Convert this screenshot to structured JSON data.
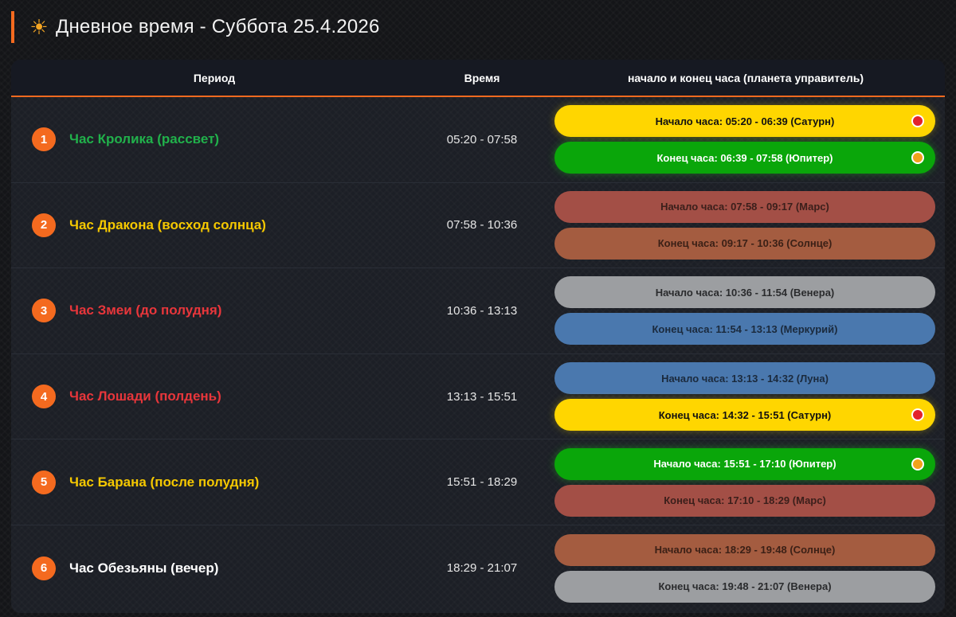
{
  "header": {
    "icon": "sun-icon",
    "title": "Дневное время - Суббота 25.4.2026",
    "accent": "#f46a1f"
  },
  "table": {
    "columns": {
      "period": "Период",
      "time": "Время",
      "hours": "начало и конец часа (планета управитель)"
    },
    "rows": [
      {
        "num": "1",
        "name": "Час Кролика (рассвет)",
        "name_color": "#21b14b",
        "time": "05:20 - 07:58",
        "hours": [
          {
            "label": "Начало часа: 05:20 - 06:39 (Сатурн)",
            "bg": "#ffd600",
            "fg": "#111111",
            "active": true,
            "dot": "#e3222b"
          },
          {
            "label": "Конец часа: 06:39 - 07:58 (Юпитер)",
            "bg": "#0aa60a",
            "fg": "#ffffff",
            "active": true,
            "dot": "#f2a21b"
          }
        ]
      },
      {
        "num": "2",
        "name": "Час Дракона (восход солнца)",
        "name_color": "#f5c800",
        "time": "07:58 - 10:36",
        "hours": [
          {
            "label": "Начало часа: 07:58 - 09:17 (Марс)",
            "bg": "#a34f46",
            "fg": "#3b1f1b",
            "active": false
          },
          {
            "label": "Конец часа: 09:17 - 10:36 (Солнце)",
            "bg": "#a45c40",
            "fg": "#3b2016",
            "active": false
          }
        ]
      },
      {
        "num": "3",
        "name": "Час Змеи (до полудня)",
        "name_color": "#e8363b",
        "time": "10:36 - 13:13",
        "hours": [
          {
            "label": "Начало часа: 10:36 - 11:54 (Венера)",
            "bg": "#9c9ea1",
            "fg": "#2a2b2d",
            "active": false
          },
          {
            "label": "Конец часа: 11:54 - 13:13 (Меркурий)",
            "bg": "#4a78ae",
            "fg": "#1b2a3d",
            "active": false
          }
        ]
      },
      {
        "num": "4",
        "name": "Час Лошади (полдень)",
        "name_color": "#e8363b",
        "time": "13:13 - 15:51",
        "hours": [
          {
            "label": "Начало часа: 13:13 - 14:32 (Луна)",
            "bg": "#4a78ae",
            "fg": "#1b2a3d",
            "active": false
          },
          {
            "label": "Конец часа: 14:32 - 15:51 (Сатурн)",
            "bg": "#ffd600",
            "fg": "#111111",
            "active": true,
            "dot": "#e3222b"
          }
        ]
      },
      {
        "num": "5",
        "name": "Час Барана (после полудня)",
        "name_color": "#f5c800",
        "time": "15:51 - 18:29",
        "hours": [
          {
            "label": "Начало часа: 15:51 - 17:10 (Юпитер)",
            "bg": "#0aa60a",
            "fg": "#ffffff",
            "active": true,
            "dot": "#f2a21b"
          },
          {
            "label": "Конец часа: 17:10 - 18:29 (Марс)",
            "bg": "#a34f46",
            "fg": "#3b1f1b",
            "active": false
          }
        ]
      },
      {
        "num": "6",
        "name": "Час Обезьяны (вечер)",
        "name_color": "#ffffff",
        "time": "18:29 - 21:07",
        "hours": [
          {
            "label": "Начало часа: 18:29 - 19:48 (Солнце)",
            "bg": "#a45c40",
            "fg": "#3b2016",
            "active": false
          },
          {
            "label": "Конец часа: 19:48 - 21:07 (Венера)",
            "bg": "#9c9ea1",
            "fg": "#2a2b2d",
            "active": false
          }
        ]
      }
    ]
  }
}
